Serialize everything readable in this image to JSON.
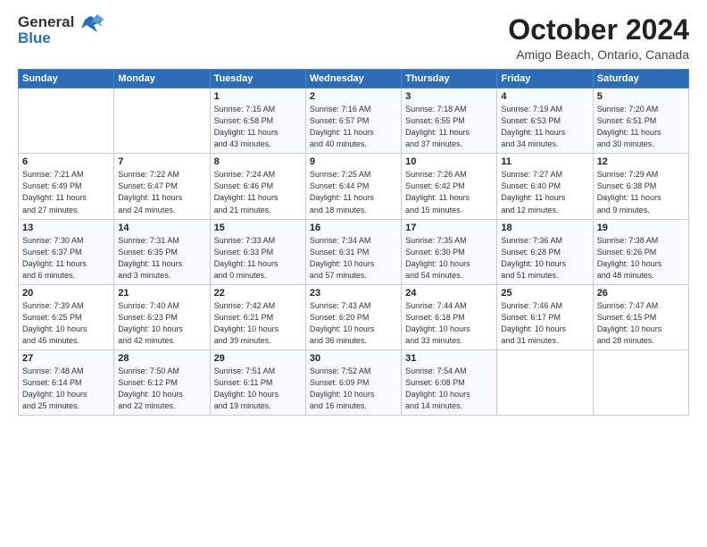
{
  "logo": {
    "line1": "General",
    "line2": "Blue"
  },
  "header": {
    "month": "October 2024",
    "location": "Amigo Beach, Ontario, Canada"
  },
  "columns": [
    "Sunday",
    "Monday",
    "Tuesday",
    "Wednesday",
    "Thursday",
    "Friday",
    "Saturday"
  ],
  "weeks": [
    [
      {
        "day": "",
        "info": ""
      },
      {
        "day": "",
        "info": ""
      },
      {
        "day": "1",
        "info": "Sunrise: 7:15 AM\nSunset: 6:58 PM\nDaylight: 11 hours\nand 43 minutes."
      },
      {
        "day": "2",
        "info": "Sunrise: 7:16 AM\nSunset: 6:57 PM\nDaylight: 11 hours\nand 40 minutes."
      },
      {
        "day": "3",
        "info": "Sunrise: 7:18 AM\nSunset: 6:55 PM\nDaylight: 11 hours\nand 37 minutes."
      },
      {
        "day": "4",
        "info": "Sunrise: 7:19 AM\nSunset: 6:53 PM\nDaylight: 11 hours\nand 34 minutes."
      },
      {
        "day": "5",
        "info": "Sunrise: 7:20 AM\nSunset: 6:51 PM\nDaylight: 11 hours\nand 30 minutes."
      }
    ],
    [
      {
        "day": "6",
        "info": "Sunrise: 7:21 AM\nSunset: 6:49 PM\nDaylight: 11 hours\nand 27 minutes."
      },
      {
        "day": "7",
        "info": "Sunrise: 7:22 AM\nSunset: 6:47 PM\nDaylight: 11 hours\nand 24 minutes."
      },
      {
        "day": "8",
        "info": "Sunrise: 7:24 AM\nSunset: 6:46 PM\nDaylight: 11 hours\nand 21 minutes."
      },
      {
        "day": "9",
        "info": "Sunrise: 7:25 AM\nSunset: 6:44 PM\nDaylight: 11 hours\nand 18 minutes."
      },
      {
        "day": "10",
        "info": "Sunrise: 7:26 AM\nSunset: 6:42 PM\nDaylight: 11 hours\nand 15 minutes."
      },
      {
        "day": "11",
        "info": "Sunrise: 7:27 AM\nSunset: 6:40 PM\nDaylight: 11 hours\nand 12 minutes."
      },
      {
        "day": "12",
        "info": "Sunrise: 7:29 AM\nSunset: 6:38 PM\nDaylight: 11 hours\nand 9 minutes."
      }
    ],
    [
      {
        "day": "13",
        "info": "Sunrise: 7:30 AM\nSunset: 6:37 PM\nDaylight: 11 hours\nand 6 minutes."
      },
      {
        "day": "14",
        "info": "Sunrise: 7:31 AM\nSunset: 6:35 PM\nDaylight: 11 hours\nand 3 minutes."
      },
      {
        "day": "15",
        "info": "Sunrise: 7:33 AM\nSunset: 6:33 PM\nDaylight: 11 hours\nand 0 minutes."
      },
      {
        "day": "16",
        "info": "Sunrise: 7:34 AM\nSunset: 6:31 PM\nDaylight: 10 hours\nand 57 minutes."
      },
      {
        "day": "17",
        "info": "Sunrise: 7:35 AM\nSunset: 6:30 PM\nDaylight: 10 hours\nand 54 minutes."
      },
      {
        "day": "18",
        "info": "Sunrise: 7:36 AM\nSunset: 6:28 PM\nDaylight: 10 hours\nand 51 minutes."
      },
      {
        "day": "19",
        "info": "Sunrise: 7:38 AM\nSunset: 6:26 PM\nDaylight: 10 hours\nand 48 minutes."
      }
    ],
    [
      {
        "day": "20",
        "info": "Sunrise: 7:39 AM\nSunset: 6:25 PM\nDaylight: 10 hours\nand 45 minutes."
      },
      {
        "day": "21",
        "info": "Sunrise: 7:40 AM\nSunset: 6:23 PM\nDaylight: 10 hours\nand 42 minutes."
      },
      {
        "day": "22",
        "info": "Sunrise: 7:42 AM\nSunset: 6:21 PM\nDaylight: 10 hours\nand 39 minutes."
      },
      {
        "day": "23",
        "info": "Sunrise: 7:43 AM\nSunset: 6:20 PM\nDaylight: 10 hours\nand 36 minutes."
      },
      {
        "day": "24",
        "info": "Sunrise: 7:44 AM\nSunset: 6:18 PM\nDaylight: 10 hours\nand 33 minutes."
      },
      {
        "day": "25",
        "info": "Sunrise: 7:46 AM\nSunset: 6:17 PM\nDaylight: 10 hours\nand 31 minutes."
      },
      {
        "day": "26",
        "info": "Sunrise: 7:47 AM\nSunset: 6:15 PM\nDaylight: 10 hours\nand 28 minutes."
      }
    ],
    [
      {
        "day": "27",
        "info": "Sunrise: 7:48 AM\nSunset: 6:14 PM\nDaylight: 10 hours\nand 25 minutes."
      },
      {
        "day": "28",
        "info": "Sunrise: 7:50 AM\nSunset: 6:12 PM\nDaylight: 10 hours\nand 22 minutes."
      },
      {
        "day": "29",
        "info": "Sunrise: 7:51 AM\nSunset: 6:11 PM\nDaylight: 10 hours\nand 19 minutes."
      },
      {
        "day": "30",
        "info": "Sunrise: 7:52 AM\nSunset: 6:09 PM\nDaylight: 10 hours\nand 16 minutes."
      },
      {
        "day": "31",
        "info": "Sunrise: 7:54 AM\nSunset: 6:08 PM\nDaylight: 10 hours\nand 14 minutes."
      },
      {
        "day": "",
        "info": ""
      },
      {
        "day": "",
        "info": ""
      }
    ]
  ]
}
